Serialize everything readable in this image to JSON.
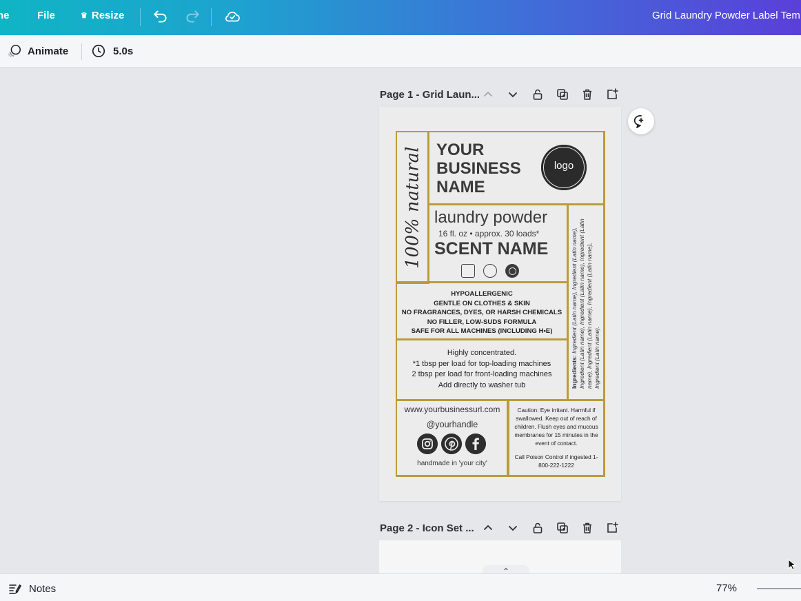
{
  "topbar": {
    "home_label": "ne",
    "file_label": "File",
    "resize_label": "Resize",
    "design_title": "Grid Laundry Powder Label Tem"
  },
  "toolbar": {
    "animate_label": "Animate",
    "duration_label": "5.0s"
  },
  "pages": [
    {
      "title": "Page 1 - Grid Laun..."
    },
    {
      "title": "Page 2 - Icon Set ..."
    }
  ],
  "label": {
    "natural_text": "100% natural",
    "business_name": "YOUR BUSINESS NAME",
    "logo_text": "logo",
    "product_name": "laundry powder",
    "product_size": "16 fl. oz • approx. 30 loads*",
    "scent_name": "SCENT NAME",
    "ingredients_heading": "Ingredients:",
    "ingredients_text": "Ingredient (Latin name), Ingredient (Latin name), Ingredient (Latin name), Ingredient (Latin name), Ingredient (Latin name), Ingredient (Latin name), Ingredient (Latin name), Ingredient (Latin name).",
    "claims": [
      "HYPOALLERGENIC",
      "GENTLE ON CLOTHES & SKIN",
      "NO FRAGRANCES, DYES, OR HARSH CHEMICALS",
      "NO FILLER, LOW-SUDS FORMULA",
      "SAFE FOR ALL MACHINES (INCLUDING H•E)"
    ],
    "usage": [
      "Highly concentrated.",
      "*1 tbsp per load for top-loading machines",
      "2 tbsp per load for front-loading machines",
      "Add directly to washer tub"
    ],
    "url": "www.yourbusinessurl.com",
    "handle": "@yourhandle",
    "handmade": "handmade in 'your city'",
    "caution": "Caution: Eye irritant. Harmful if swallowed. Keep out of reach of children. Flush eyes and mucous membranes for 15 minutes in the event of contact.",
    "poison_control": "Call Poison Control if ingested 1-800-222-1222"
  },
  "bottombar": {
    "notes_label": "Notes",
    "zoom": "77%"
  },
  "icons": [
    "undo-icon",
    "redo-icon",
    "cloud-sync-icon",
    "animate-icon",
    "clock-icon",
    "chevron-up-icon",
    "chevron-down-icon",
    "lock-icon",
    "duplicate-icon",
    "trash-icon",
    "add-page-icon",
    "add-comment-icon",
    "instagram-icon",
    "pinterest-icon",
    "facebook-icon",
    "notes-icon"
  ]
}
